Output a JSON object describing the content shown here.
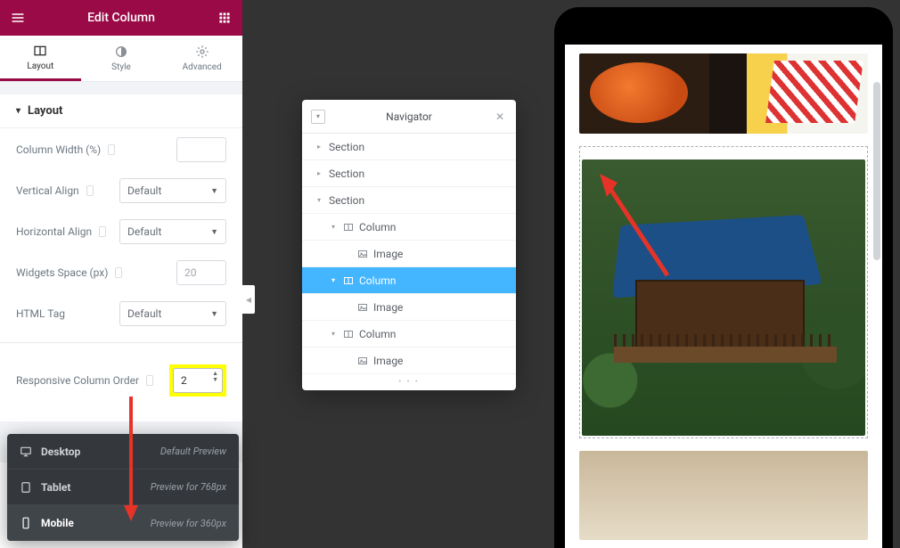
{
  "panel": {
    "title": "Edit Column",
    "tabs": [
      {
        "label": "Layout",
        "name": "tab-layout",
        "active": true
      },
      {
        "label": "Style",
        "name": "tab-style",
        "active": false
      },
      {
        "label": "Advanced",
        "name": "tab-advanced",
        "active": false
      }
    ],
    "section_title": "Layout",
    "rows": {
      "column_width": {
        "label": "Column Width (%)",
        "value": ""
      },
      "vertical_align": {
        "label": "Vertical Align",
        "value": "Default"
      },
      "horizontal_align": {
        "label": "Horizontal Align",
        "value": "Default"
      },
      "widgets_space": {
        "label": "Widgets Space (px)",
        "placeholder": "20"
      },
      "html_tag": {
        "label": "HTML Tag",
        "value": "Default"
      },
      "responsive_order": {
        "label": "Responsive Column Order",
        "value": "2"
      }
    }
  },
  "devices": [
    {
      "name": "desktop",
      "label": "Desktop",
      "hint": "Default Preview",
      "active": false
    },
    {
      "name": "tablet",
      "label": "Tablet",
      "hint": "Preview for 768px",
      "active": false
    },
    {
      "name": "mobile",
      "label": "Mobile",
      "hint": "Preview for 360px",
      "active": true
    }
  ],
  "navigator": {
    "title": "Navigator",
    "tree": [
      {
        "depth": 0,
        "label": "Section",
        "expand": "right",
        "icon": null,
        "sel": false
      },
      {
        "depth": 0,
        "label": "Section",
        "expand": "right",
        "icon": null,
        "sel": false
      },
      {
        "depth": 0,
        "label": "Section",
        "expand": "down",
        "icon": null,
        "sel": false
      },
      {
        "depth": 1,
        "label": "Column",
        "expand": "down",
        "icon": "column",
        "sel": false
      },
      {
        "depth": 2,
        "label": "Image",
        "expand": null,
        "icon": "image",
        "sel": false
      },
      {
        "depth": 1,
        "label": "Column",
        "expand": "down",
        "icon": "column",
        "sel": true
      },
      {
        "depth": 2,
        "label": "Image",
        "expand": null,
        "icon": "image",
        "sel": false
      },
      {
        "depth": 1,
        "label": "Column",
        "expand": "down",
        "icon": "column",
        "sel": false
      },
      {
        "depth": 2,
        "label": "Image",
        "expand": null,
        "icon": "image",
        "sel": false
      }
    ]
  }
}
